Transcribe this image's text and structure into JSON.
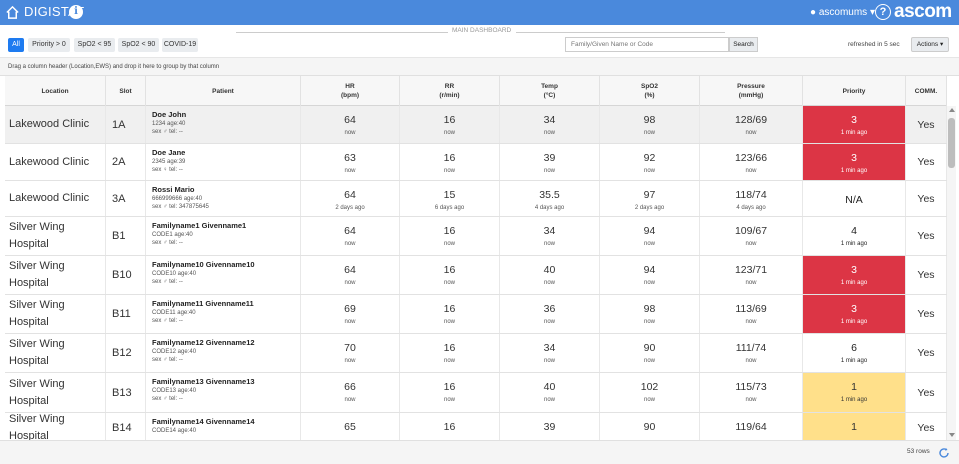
{
  "app": {
    "name": "DIGISTAT",
    "user": "ascomums",
    "brand": "ascom"
  },
  "toolbar": {
    "section_title": "MAIN DASHBOARD",
    "filters": [
      "All",
      "Priority > 0",
      "SpO2 < 95",
      "SpO2 < 90",
      "COVID-19"
    ],
    "search_placeholder": "Family/Given Name or Code",
    "search_label": "Search",
    "refreshed": "refreshed in 5 sec",
    "actions_label": "Actions"
  },
  "group_hint": "Drag a column header (Location,EWS) and drop it here to group by that column",
  "columns": [
    "Location",
    "Slot",
    "Patient",
    "HR\n(bpm)",
    "RR\n(r/min)",
    "Temp\n(°C)",
    "SpO2\n(%)",
    "Pressure\n(mmHg)",
    "Priority",
    "COMM."
  ],
  "rows": [
    {
      "location": "Lakewood Clinic",
      "slot": "1A",
      "name": "Doe John",
      "info": "1234 age:40",
      "sex": "sex ♂   tel: --",
      "hr": "64",
      "hr_t": "now",
      "rr": "16",
      "rr_t": "now",
      "temp": "34",
      "temp_t": "now",
      "spo2": "98",
      "spo2_t": "now",
      "bp": "128/69",
      "bp_t": "now",
      "prio": "3",
      "prio_t": "1 min ago",
      "prio_color": "red",
      "comm": "Yes"
    },
    {
      "location": "Lakewood Clinic",
      "slot": "2A",
      "name": "Doe Jane",
      "info": "2345 age:39",
      "sex": "sex ♀   tel: --",
      "hr": "63",
      "hr_t": "now",
      "rr": "16",
      "rr_t": "now",
      "temp": "39",
      "temp_t": "now",
      "spo2": "92",
      "spo2_t": "now",
      "bp": "123/66",
      "bp_t": "now",
      "prio": "3",
      "prio_t": "1 min ago",
      "prio_color": "red",
      "comm": "Yes"
    },
    {
      "location": "Lakewood Clinic",
      "slot": "3A",
      "name": "Rossi Mario",
      "info": "666999666 age:40",
      "sex": "sex ♂   tel: 347875645",
      "hr": "64",
      "hr_t": "2 days ago",
      "rr": "15",
      "rr_t": "6 days ago",
      "temp": "35.5",
      "temp_t": "4 days ago",
      "spo2": "97",
      "spo2_t": "2 days ago",
      "bp": "118/74",
      "bp_t": "4 days ago",
      "prio": "N/A",
      "prio_t": "",
      "prio_color": "none",
      "comm": "Yes"
    },
    {
      "location": "Silver Wing Hospital",
      "slot": "B1",
      "name": "Familyname1 Givenname1",
      "info": "CODE1 age:40",
      "sex": "sex ♂   tel: --",
      "hr": "64",
      "hr_t": "now",
      "rr": "16",
      "rr_t": "now",
      "temp": "34",
      "temp_t": "now",
      "spo2": "94",
      "spo2_t": "now",
      "bp": "109/67",
      "bp_t": "now",
      "prio": "4",
      "prio_t": "1 min ago",
      "prio_color": "none",
      "comm": "Yes"
    },
    {
      "location": "Silver Wing Hospital",
      "slot": "B10",
      "name": "Familyname10 Givenname10",
      "info": "CODE10 age:40",
      "sex": "sex ♂   tel: --",
      "hr": "64",
      "hr_t": "now",
      "rr": "16",
      "rr_t": "now",
      "temp": "40",
      "temp_t": "now",
      "spo2": "94",
      "spo2_t": "now",
      "bp": "123/71",
      "bp_t": "now",
      "prio": "3",
      "prio_t": "1 min ago",
      "prio_color": "red",
      "comm": "Yes"
    },
    {
      "location": "Silver Wing Hospital",
      "slot": "B11",
      "name": "Familyname11 Givenname11",
      "info": "CODE11 age:40",
      "sex": "sex ♂   tel: --",
      "hr": "69",
      "hr_t": "now",
      "rr": "16",
      "rr_t": "now",
      "temp": "36",
      "temp_t": "now",
      "spo2": "98",
      "spo2_t": "now",
      "bp": "113/69",
      "bp_t": "now",
      "prio": "3",
      "prio_t": "1 min ago",
      "prio_color": "red",
      "comm": "Yes"
    },
    {
      "location": "Silver Wing Hospital",
      "slot": "B12",
      "name": "Familyname12 Givenname12",
      "info": "CODE12 age:40",
      "sex": "sex ♂   tel: --",
      "hr": "70",
      "hr_t": "now",
      "rr": "16",
      "rr_t": "now",
      "temp": "34",
      "temp_t": "now",
      "spo2": "90",
      "spo2_t": "now",
      "bp": "111/74",
      "bp_t": "now",
      "prio": "6",
      "prio_t": "1 min ago",
      "prio_color": "none",
      "comm": "Yes"
    },
    {
      "location": "Silver Wing Hospital",
      "slot": "B13",
      "name": "Familyname13 Givenname13",
      "info": "CODE13 age:40",
      "sex": "sex ♂   tel: --",
      "hr": "66",
      "hr_t": "now",
      "rr": "16",
      "rr_t": "now",
      "temp": "40",
      "temp_t": "now",
      "spo2": "102",
      "spo2_t": "now",
      "bp": "115/73",
      "bp_t": "now",
      "prio": "1",
      "prio_t": "1 min ago",
      "prio_color": "yellow",
      "comm": "Yes"
    },
    {
      "location": "Silver Wing Hospital",
      "slot": "B14",
      "name": "Familyname14 Givenname14",
      "info": "CODE14 age:40",
      "sex": "",
      "hr": "65",
      "hr_t": "",
      "rr": "16",
      "rr_t": "",
      "temp": "39",
      "temp_t": "",
      "spo2": "90",
      "spo2_t": "",
      "bp": "119/64",
      "bp_t": "",
      "prio": "1",
      "prio_t": "",
      "prio_color": "yellow",
      "comm": "Yes"
    }
  ],
  "footer": {
    "rows": "53 rows"
  }
}
